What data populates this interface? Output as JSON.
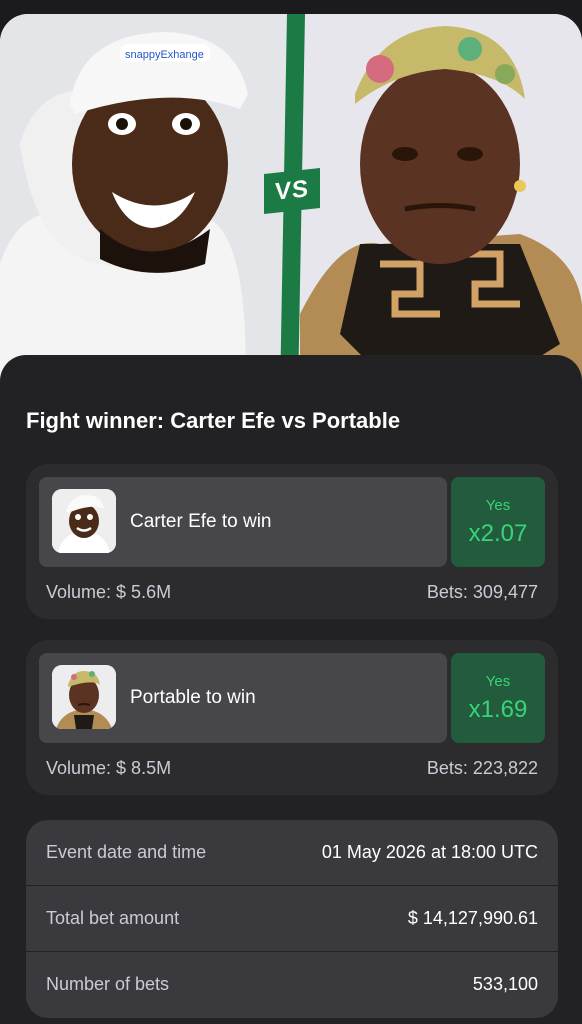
{
  "hero": {
    "vs_label": "VS",
    "cap_text": "snappyExhange"
  },
  "title": "Fight winner: Carter Efe vs Portable",
  "markets": [
    {
      "outcome": "Carter Efe to win",
      "side": "Yes",
      "odds": "x2.07",
      "volume": "Volume: $ 5.6M",
      "bets": "Bets: 309,477"
    },
    {
      "outcome": "Portable to win",
      "side": "Yes",
      "odds": "x1.69",
      "volume": "Volume: $ 8.5M",
      "bets": "Bets: 223,822"
    }
  ],
  "details": [
    {
      "label": "Event date and time",
      "value": "01 May 2026 at 18:00 UTC"
    },
    {
      "label": "Total bet amount",
      "value": "$ 14,127,990.61"
    },
    {
      "label": "Number of bets",
      "value": "533,100"
    }
  ],
  "colors": {
    "accent_green": "#39d37a",
    "yes_bg": "#235c3c",
    "vs_green": "#1c7a45"
  }
}
